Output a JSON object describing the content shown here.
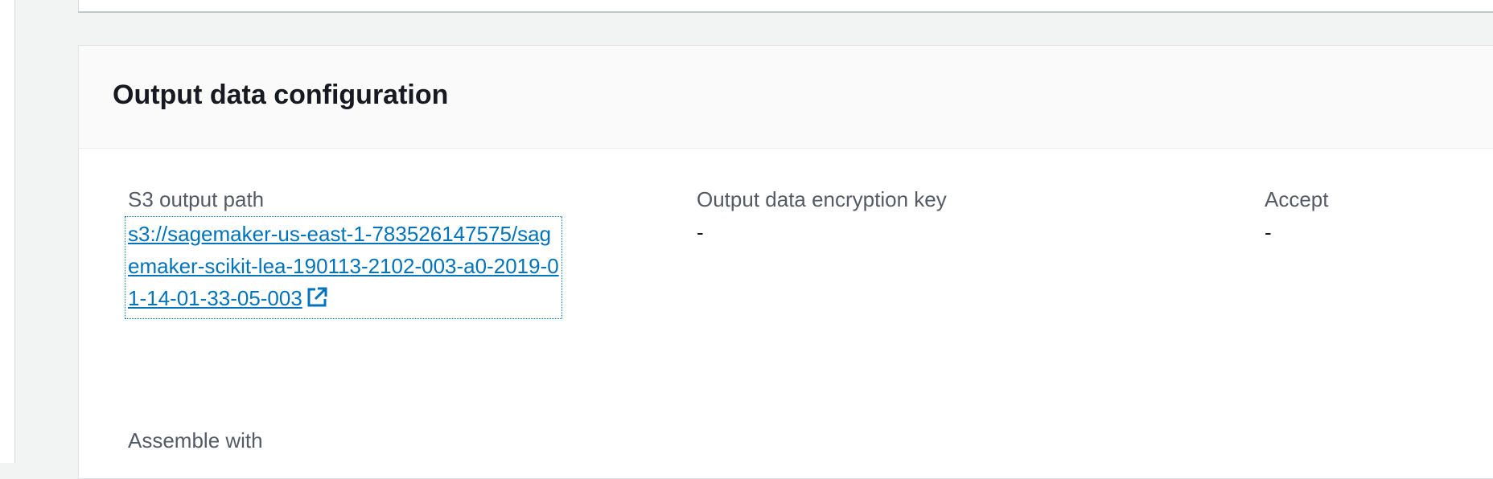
{
  "panel": {
    "title": "Output data configuration"
  },
  "fields": {
    "s3_output_path": {
      "label": "S3 output path",
      "value": "s3://sagemaker-us-east-1-783526147575/sagemaker-scikit-lea-190113-2102-003-a0-2019-01-14-01-33-05-003"
    },
    "encryption_key": {
      "label": "Output data encryption key",
      "value": "-"
    },
    "accept": {
      "label": "Accept",
      "value": "-"
    },
    "assemble_with": {
      "label": "Assemble with"
    }
  },
  "icons": {
    "external_link": "external-link-icon"
  },
  "colors": {
    "link": "#0073bb",
    "title": "#16191f",
    "label": "#545b64"
  }
}
